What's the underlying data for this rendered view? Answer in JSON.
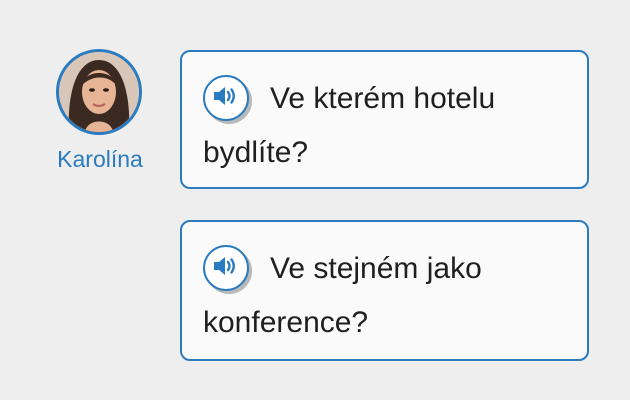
{
  "speaker": {
    "name": "Karolína",
    "avatar_icon": "person-portrait-icon"
  },
  "accent_color": "#2a7bbf",
  "messages": [
    {
      "text": "Ve kterém hotelu bydlíte?",
      "audio_icon": "speaker-audio-icon"
    },
    {
      "text": "Ve stejném jako konference?",
      "audio_icon": "speaker-audio-icon"
    }
  ]
}
